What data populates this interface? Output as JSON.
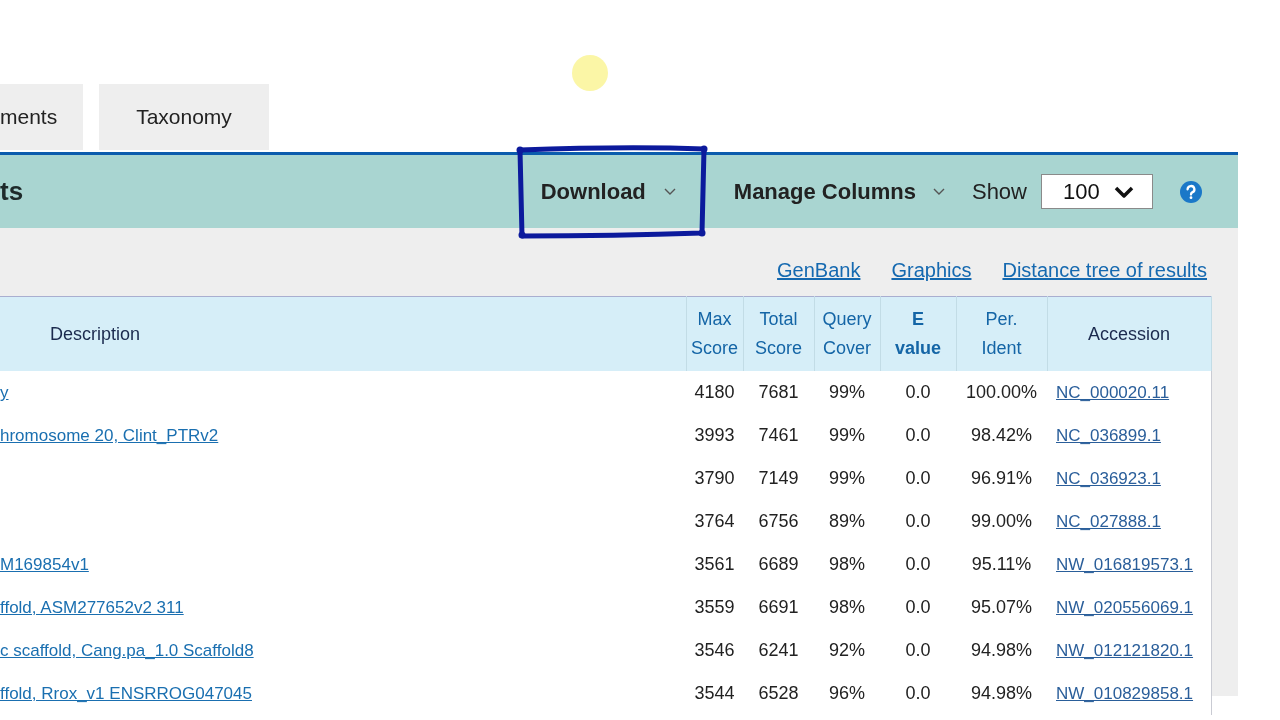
{
  "tabs": [
    {
      "label": "ments",
      "selected": false
    },
    {
      "label": "Taxonomy",
      "selected": false
    }
  ],
  "cursor_highlight": true,
  "toolbar": {
    "title": "ts",
    "download": {
      "label": "Download",
      "highlighted": true
    },
    "manage_columns": {
      "label": "Manage Columns"
    },
    "show": {
      "label": "Show",
      "value": "100"
    }
  },
  "links": [
    "GenBank",
    "Graphics",
    "Distance tree of results"
  ],
  "table": {
    "columns": [
      {
        "lines": [
          "Description"
        ],
        "sortable": false,
        "sorted": false
      },
      {
        "lines": [
          "Max",
          "Score"
        ],
        "sortable": true,
        "sorted": false
      },
      {
        "lines": [
          "Total",
          "Score"
        ],
        "sortable": true,
        "sorted": false
      },
      {
        "lines": [
          "Query",
          "Cover"
        ],
        "sortable": true,
        "sorted": false
      },
      {
        "lines": [
          "E",
          "value"
        ],
        "sortable": true,
        "sorted": true
      },
      {
        "lines": [
          "Per.",
          "Ident"
        ],
        "sortable": true,
        "sorted": false
      },
      {
        "lines": [
          "Accession"
        ],
        "sortable": false,
        "sorted": false
      }
    ],
    "rows": [
      {
        "description": "y",
        "values": [
          "4180",
          "7681",
          "99%",
          "0.0",
          "100.00%"
        ],
        "accession": "NC_000020.11"
      },
      {
        "description": "hromosome 20, Clint_PTRv2",
        "values": [
          "3993",
          "7461",
          "99%",
          "0.0",
          "98.42%"
        ],
        "accession": "NC_036899.1"
      },
      {
        "values": [
          "3790",
          "7149",
          "99%",
          "0.0",
          "96.91%"
        ],
        "accession": "NC_036923.1"
      },
      {
        "values": [
          "3764",
          "6756",
          "89%",
          "0.0",
          "99.00%"
        ],
        "accession": "NC_027888.1"
      },
      {
        "description": "M169854v1",
        "values": [
          "3561",
          "6689",
          "98%",
          "0.0",
          "95.11%"
        ],
        "accession": "NW_016819573.1"
      },
      {
        "description": "ffold, ASM277652v2 311",
        "values": [
          "3559",
          "6691",
          "98%",
          "0.0",
          "95.07%"
        ],
        "accession": "NW_020556069.1"
      },
      {
        "description": "c scaffold, Cang.pa_1.0 Scaffold8",
        "values": [
          "3546",
          "6241",
          "92%",
          "0.0",
          "94.98%"
        ],
        "accession": "NW_012121820.1"
      },
      {
        "description": "ffold, Rrox_v1 ENSRROG047045",
        "values": [
          "3544",
          "6528",
          "96%",
          "0.0",
          "94.98%"
        ],
        "accession": "NW_010829858.1"
      }
    ]
  }
}
